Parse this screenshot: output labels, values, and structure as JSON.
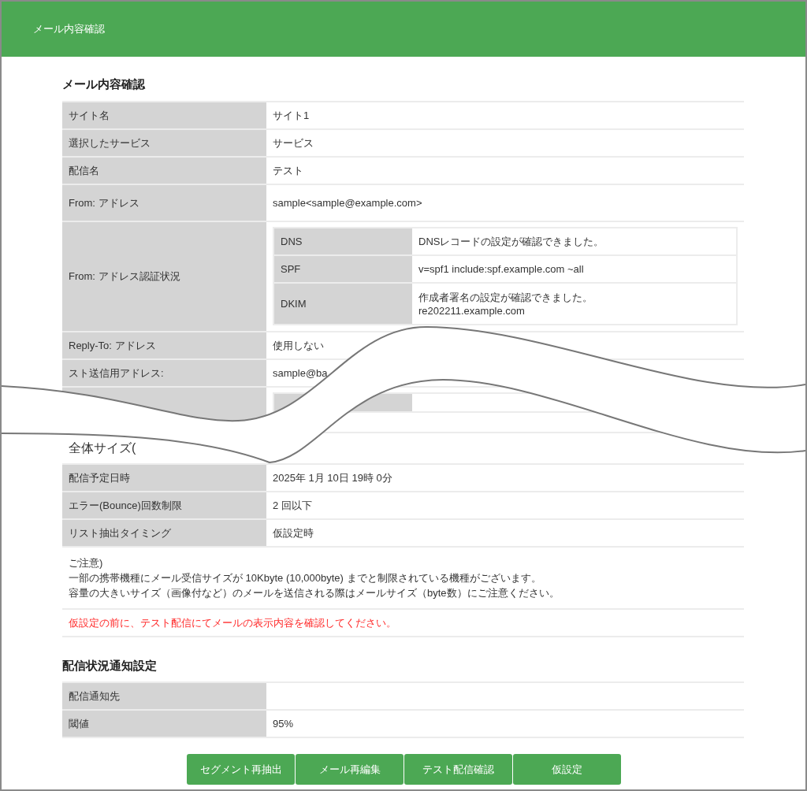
{
  "header": {
    "title": "メール内容確認"
  },
  "mail_section": {
    "title": "メール内容確認",
    "rows": [
      {
        "kind": "text",
        "label": "サイト名",
        "value": "サイト1"
      },
      {
        "kind": "text",
        "label": "選択したサービス",
        "value": "サービス"
      },
      {
        "kind": "text",
        "label": "配信名",
        "value": "テスト"
      },
      {
        "kind": "tall",
        "label": "From: アドレス",
        "value": "sample<sample@example.com>"
      },
      {
        "kind": "auth",
        "label": "From: アドレス認証状況",
        "sub_rows": [
          {
            "label": "DNS",
            "value": "DNSレコードの設定が確認できました。"
          },
          {
            "label": "SPF",
            "value": "v=spf1 include:spf.example.com ~all"
          },
          {
            "label": "DKIM",
            "value": "作成者署名の設定が確認できました。\nre202211.example.com"
          }
        ]
      },
      {
        "kind": "text",
        "label": "Reply-To: アドレス",
        "value": "使用しない"
      },
      {
        "kind": "text",
        "label": "スト送信用アドレス:",
        "value": "sample@ba"
      },
      {
        "kind": "cut"
      },
      {
        "kind": "heading",
        "label": "全体サイズ("
      },
      {
        "kind": "text",
        "label": "配信予定日時",
        "value": "2025年 1月 10日 19時 0分"
      },
      {
        "kind": "text",
        "label": "エラー(Bounce)回数制限",
        "value": "2 回以下"
      },
      {
        "kind": "text",
        "label": "リスト抽出タイミング",
        "value": "仮設定時"
      }
    ],
    "note_lines": [
      "ご注意)",
      "一部の携帯機種にメール受信サイズが 10Kbyte (10,000byte) までと制限されている機種がございます。",
      "容量の大きいサイズ（画像付など）のメールを送信される際はメールサイズ（byte数）にご注意ください。"
    ],
    "warning": "仮設定の前に、テスト配信にてメールの表示内容を確認してください。"
  },
  "notify_section": {
    "title": "配信状況通知設定",
    "rows": [
      {
        "label": "配信通知先"
      },
      {
        "label": "閾値",
        "value": "95%"
      }
    ]
  },
  "buttons": [
    "セグメント再抽出",
    "メール再編集",
    "テスト配信確認",
    "仮設定"
  ]
}
